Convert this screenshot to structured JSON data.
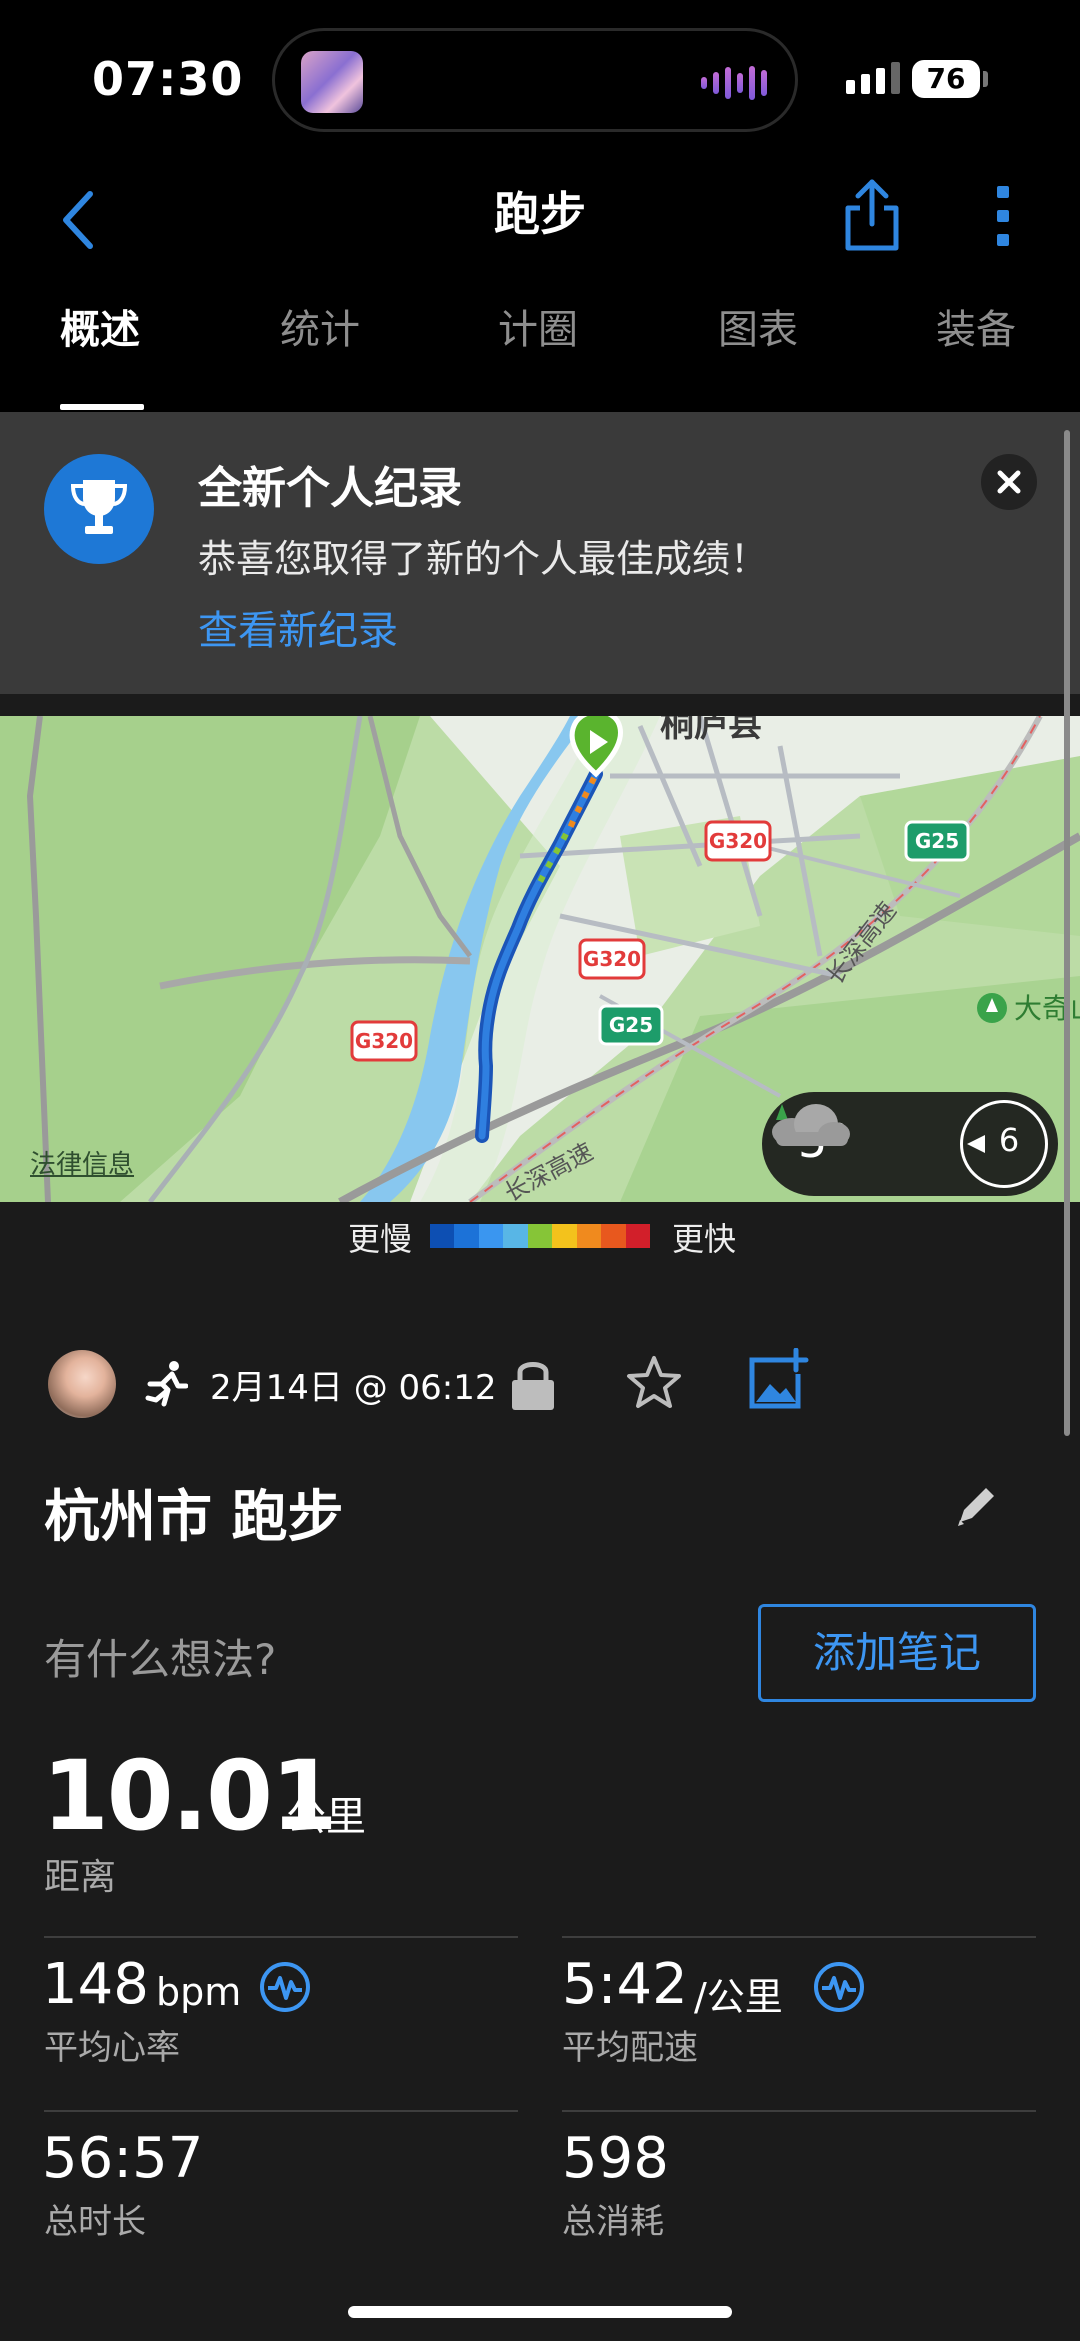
{
  "status_bar": {
    "time": "07:30",
    "battery": "76"
  },
  "header": {
    "title": "跑步"
  },
  "tabs": [
    {
      "label": "概述",
      "active": true
    },
    {
      "label": "统计",
      "active": false
    },
    {
      "label": "计圈",
      "active": false
    },
    {
      "label": "图表",
      "active": false
    },
    {
      "label": "装备",
      "active": false
    }
  ],
  "record_banner": {
    "title": "全新个人纪录",
    "message": "恭喜您取得了新的个人最佳成绩！",
    "link": "查看新纪录"
  },
  "map": {
    "city_label": "桐庐县",
    "road_labels": [
      "G320",
      "G320",
      "G320",
      "G25",
      "G25"
    ],
    "highway_labels": [
      "长深高速",
      "长深高速"
    ],
    "poi_label": "大奇山",
    "legal": "法律信息",
    "weather": {
      "temperature": "5°",
      "wind": "6"
    }
  },
  "speed_legend": {
    "slow": "更慢",
    "fast": "更快",
    "colors": [
      "#0d4fb3",
      "#1c72d8",
      "#3a96f0",
      "#58b6e6",
      "#86c537",
      "#f3c21c",
      "#f08a1e",
      "#e8581e",
      "#d21f2a"
    ]
  },
  "activity": {
    "date": "2月14日 @ 06:12",
    "title": "杭州市 跑步",
    "thoughts_placeholder": "有什么想法?",
    "add_note": "添加笔记"
  },
  "stats": {
    "distance": {
      "value": "10.01",
      "unit": "公里",
      "label": "距离"
    },
    "avg_hr": {
      "value": "148",
      "unit": "bpm",
      "label": "平均心率"
    },
    "avg_pace": {
      "value": "5:42",
      "unit": "/公里",
      "label": "平均配速"
    },
    "duration": {
      "value": "56:57",
      "label": "总时长"
    },
    "calories": {
      "value": "598",
      "label": "总消耗"
    }
  }
}
